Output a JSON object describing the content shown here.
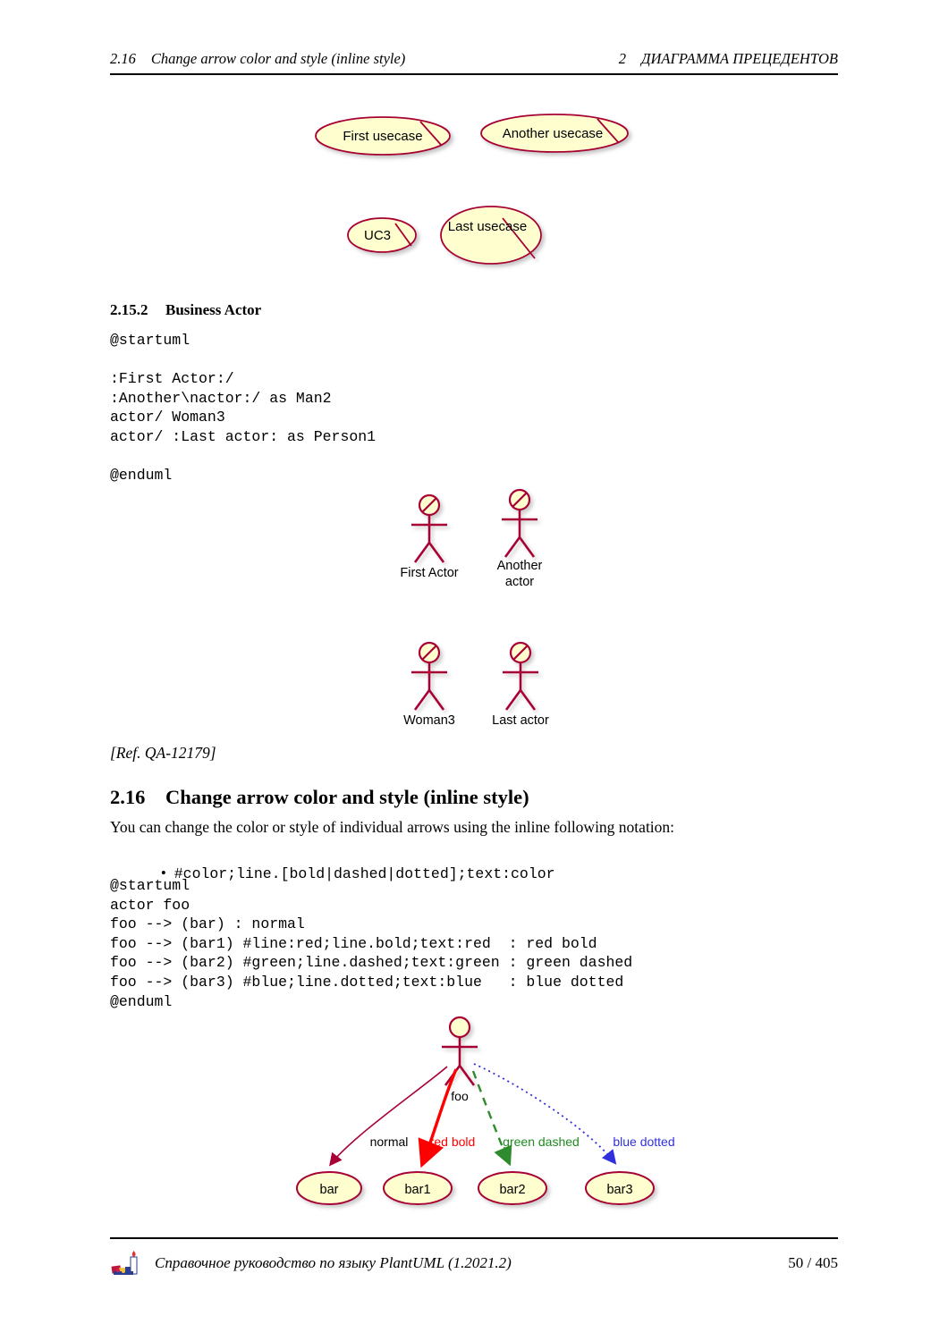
{
  "header": {
    "left_number": "2.16",
    "left_title": "Change arrow color and style (inline style)",
    "right_number": "2",
    "right_title": "ДИАГРАММА ПРЕЦЕДЕНТОВ"
  },
  "usecase_diagram": {
    "nodes": [
      {
        "label": "First usecase",
        "business": true
      },
      {
        "label": "Another usecase",
        "business": true
      },
      {
        "label": "UC3",
        "business": true
      },
      {
        "label": "Last usecase",
        "business": true
      }
    ],
    "colors": {
      "fill": "#FEFECE",
      "border": "#A80036",
      "shadow": "#BEBEBE"
    }
  },
  "section_2_15_2": {
    "number": "2.15.2",
    "title": "Business Actor",
    "code": "@startuml\n\n:First Actor:/\n:Another\\nactor:/ as Man2\nactor/ Woman3\nactor/ :Last actor: as Person1\n\n@enduml"
  },
  "actor_diagram": {
    "actors": [
      {
        "label": "First Actor",
        "label2": "",
        "business": true
      },
      {
        "label": "Another",
        "label2": "actor",
        "business": true
      },
      {
        "label": "Woman3",
        "label2": "",
        "business": true
      },
      {
        "label": "Last actor",
        "label2": "",
        "business": true
      }
    ],
    "colors": {
      "fill": "#FEFECE",
      "stroke": "#A80036",
      "text": "#000000"
    }
  },
  "ref_note": "[Ref. QA-12179]",
  "section_2_16": {
    "number": "2.16",
    "title": "Change arrow color and style (inline style)",
    "intro": "You can change the color or style of individual arrows using the inline following notation:",
    "bullet": "#color;line.[bold|dashed|dotted];text:color",
    "code": "@startuml\nactor foo\nfoo --> (bar) : normal\nfoo --> (bar1) #line:red;line.bold;text:red  : red bold\nfoo --> (bar2) #green;line.dashed;text:green : green dashed\nfoo --> (bar3) #blue;line.dotted;text:blue   : blue dotted\n@enduml"
  },
  "arrow_diagram": {
    "actor_label": "foo",
    "nodes": [
      {
        "label": "bar"
      },
      {
        "label": "bar1"
      },
      {
        "label": "bar2"
      },
      {
        "label": "bar3"
      }
    ],
    "arrows": [
      {
        "label": "normal",
        "color": "#A80036",
        "text_color": "#000000",
        "style": "solid",
        "width": 1.6
      },
      {
        "label": "red bold",
        "color": "#FF0000",
        "text_color": "#FF0000",
        "style": "solid",
        "width": 3.4
      },
      {
        "label": "green dashed",
        "color": "#2E8B2E",
        "text_color": "#1E8B1E",
        "style": "dashed",
        "width": 2.4
      },
      {
        "label": "blue dotted",
        "color": "#4040D0",
        "text_color": "#3030DD",
        "style": "dotted",
        "width": 1.8
      }
    ],
    "colors": {
      "fill": "#FEFECE",
      "border": "#A80036"
    }
  },
  "footer": {
    "logo": "plantuml-logo-icon",
    "title": "Справочное руководство по языку PlantUML (1.2021.2)",
    "page": "50 / 405"
  }
}
